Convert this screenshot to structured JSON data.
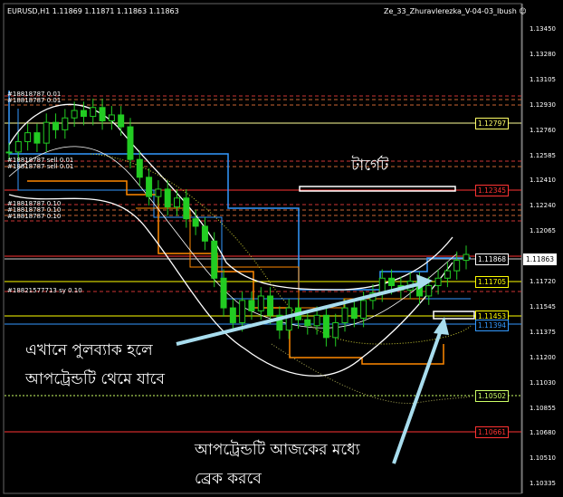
{
  "header": {
    "symbol_info": "EURUSD,H1  1.11869 1.11871 1.11863 1.11863",
    "indicator_name": "Ze_33_Zhuravlerezka_V-04-03_Ibush",
    "smiley_icon": "smiley-icon"
  },
  "order_labels": [
    {
      "text": "#18818787",
      "suffix": "0.01",
      "y": 104
    },
    {
      "text": "#18818787",
      "suffix": "0.01",
      "y": 111
    },
    {
      "text": "#18818787",
      "suffix": "sell 0.01",
      "y": 177
    },
    {
      "text": "#18818787",
      "suffix": "sell 0.01",
      "y": 184
    },
    {
      "text": "#18818787",
      "suffix": "0.10",
      "y": 225
    },
    {
      "text": "#18818787",
      "suffix": "0.10",
      "y": 232
    },
    {
      "text": "#18818787",
      "suffix": "0.10",
      "y": 239
    },
    {
      "text": "#18821577713",
      "suffix": "sy 0.10",
      "y": 321
    }
  ],
  "annotations": {
    "target": "টার্গেট",
    "pullback_line1": "এখানে পুলব্যাক হলে",
    "pullback_line2": "আপট্রেন্ডটি থেমে যাবে",
    "break_line1": "আপট্রেন্ডটি আজকের মধ্যে",
    "break_line2": "ব্রেক করবে"
  },
  "price_axis": {
    "ticks": [
      "1.13450",
      "1.13280",
      "1.13105",
      "1.12930",
      "1.12760",
      "1.12585",
      "1.12410",
      "1.12240",
      "1.12065",
      "1.11895",
      "1.11720",
      "1.11545",
      "1.11375",
      "1.11200",
      "1.11030",
      "1.10855",
      "1.10680",
      "1.10510",
      "1.10335"
    ],
    "tags": [
      {
        "value": "1.12797",
        "color": "#ffff66"
      },
      {
        "value": "1.12345",
        "color": "#ff3333"
      },
      {
        "value": "1.11868",
        "color": "#ffffff"
      },
      {
        "value": "1.11863",
        "color": "#ffffff",
        "current": true
      },
      {
        "value": "1.11705",
        "color": "#ffff00"
      },
      {
        "value": "1.11453",
        "color": "#ffff00"
      },
      {
        "value": "1.11394",
        "color": "#3399ff"
      },
      {
        "value": "1.10502",
        "color": "#ccff66"
      },
      {
        "value": "1.10661",
        "color": "#ff3333"
      }
    ]
  },
  "chart_data": {
    "type": "line",
    "title": "",
    "xlabel": "",
    "ylabel": "",
    "ylim": [
      1.1025,
      1.1355
    ],
    "series": [
      {
        "values": [
          1.1255,
          1.1262,
          1.1268,
          1.1261,
          1.1275,
          1.127,
          1.1278,
          1.1283,
          1.1279,
          1.1285,
          1.1276,
          1.128,
          1.1272,
          1.125,
          1.1238,
          1.1225,
          1.123,
          1.1218,
          1.1224,
          1.121,
          1.1205,
          1.1195,
          1.117,
          1.115,
          1.114,
          1.1155,
          1.1148,
          1.1158,
          1.1145,
          1.1135,
          1.115,
          1.1142,
          1.1138,
          1.1145,
          1.113,
          1.114,
          1.115,
          1.1143,
          1.1155,
          1.116,
          1.117,
          1.1165,
          1.1162,
          1.1168,
          1.1158,
          1.1165,
          1.117,
          1.1175,
          1.1182,
          1.1186
        ]
      }
    ],
    "horizontal_levels": [
      1.12797,
      1.12345,
      1.11868,
      1.11705,
      1.11453,
      1.11394,
      1.10502,
      1.10661
    ]
  }
}
